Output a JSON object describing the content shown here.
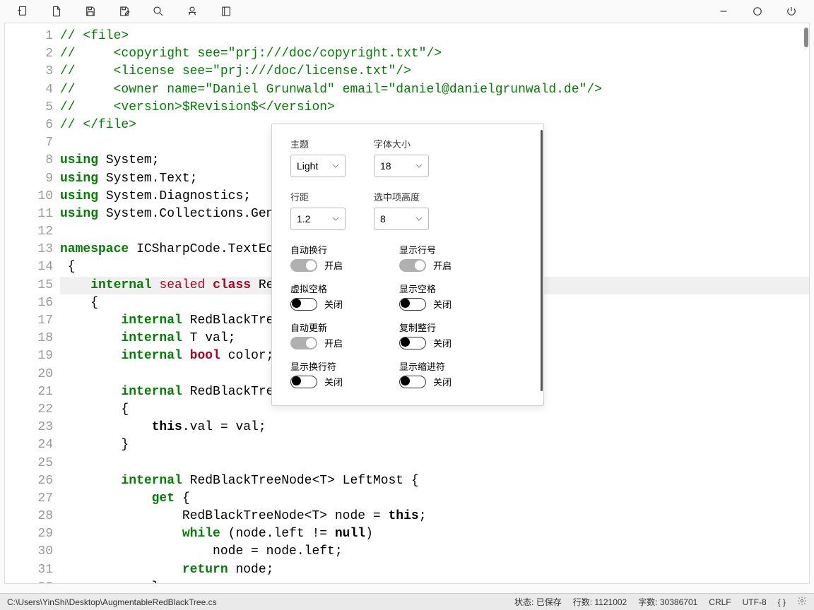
{
  "toolbar": {
    "icons": [
      "new-file-icon",
      "open-file-icon",
      "save-icon",
      "save-as-icon",
      "search-icon",
      "translate-icon",
      "book-icon"
    ],
    "right_icons": [
      "minimize-icon",
      "maximize-icon",
      "power-icon"
    ]
  },
  "settings": {
    "theme_label": "主题",
    "theme_value": "Light",
    "fontsize_label": "字体大小",
    "fontsize_value": "18",
    "lineheight_label": "行距",
    "lineheight_value": "1.2",
    "selheight_label": "选中项高度",
    "selheight_value": "8",
    "wrap_label": "自动换行",
    "wrap_state": "开启",
    "linenum_label": "显示行号",
    "linenum_state": "开启",
    "virtspace_label": "虚拟空格",
    "virtspace_state": "关闭",
    "showspace_label": "显示空格",
    "showspace_state": "关闭",
    "autoupdate_label": "自动更新",
    "autoupdate_state": "开启",
    "copyline_label": "复制整行",
    "copyline_state": "关闭",
    "showlinebreak_label": "显示换行符",
    "showlinebreak_state": "关闭",
    "showindent_label": "显示缩进符",
    "showindent_state": "关闭"
  },
  "code": {
    "lines": [
      {
        "n": 1,
        "html": "<span class='cmt'>// &lt;file&gt;</span>"
      },
      {
        "n": 2,
        "html": "<span class='cmt'>//     &lt;copyright see=\"prj:///doc/copyright.txt\"/&gt;</span>"
      },
      {
        "n": 3,
        "html": "<span class='cmt'>//     &lt;license see=\"prj:///doc/license.txt\"/&gt;</span>"
      },
      {
        "n": 4,
        "html": "<span class='cmt'>//     &lt;owner name=\"Daniel Grunwald\" email=\"daniel@danielgrunwald.de\"/&gt;</span>"
      },
      {
        "n": 5,
        "html": "<span class='cmt'>//     &lt;version&gt;$Revision$&lt;/version&gt;</span>"
      },
      {
        "n": 6,
        "html": "<span class='cmt'>// &lt;/file&gt;</span>"
      },
      {
        "n": 7,
        "html": ""
      },
      {
        "n": 8,
        "html": "<span class='kw'>using</span> System;"
      },
      {
        "n": 9,
        "html": "<span class='kw'>using</span> System.Text;"
      },
      {
        "n": 10,
        "html": "<span class='kw'>using</span> System.Diagnostics;"
      },
      {
        "n": 11,
        "html": "<span class='kw'>using</span> System.Collections.Gener"
      },
      {
        "n": 12,
        "html": ""
      },
      {
        "n": 13,
        "html": "<span class='kw'>namespace</span> ICSharpCode.TextEdit"
      },
      {
        "n": 14,
        "html": " {"
      },
      {
        "n": 15,
        "html": "    <span class='kw'>internal</span> <span class='kw3'>sealed</span> <span class='kw2'>class</span> RedB",
        "current": true
      },
      {
        "n": 16,
        "html": "    {"
      },
      {
        "n": 17,
        "html": "        <span class='kw'>internal</span> RedBlackTreeN"
      },
      {
        "n": 18,
        "html": "        <span class='kw'>internal</span> T val;"
      },
      {
        "n": 19,
        "html": "        <span class='kw'>internal</span> <span class='kw2'>bool</span> color;"
      },
      {
        "n": 20,
        "html": ""
      },
      {
        "n": 21,
        "html": "        <span class='kw'>internal</span> RedBlackTreeN"
      },
      {
        "n": 22,
        "html": "        {"
      },
      {
        "n": 23,
        "html": "            <span class='bold'>this</span>.val = val;"
      },
      {
        "n": 24,
        "html": "        }"
      },
      {
        "n": 25,
        "html": ""
      },
      {
        "n": 26,
        "html": "        <span class='kw'>internal</span> RedBlackTreeNode&lt;T&gt; LeftMost {"
      },
      {
        "n": 27,
        "html": "            <span class='kw'>get</span> {"
      },
      {
        "n": 28,
        "html": "                RedBlackTreeNode&lt;T&gt; node = <span class='bold'>this</span>;"
      },
      {
        "n": 29,
        "html": "                <span class='kw'>while</span> (node.left != <span class='bold'>null</span>)"
      },
      {
        "n": 30,
        "html": "                    node = node.left;"
      },
      {
        "n": 31,
        "html": "                <span class='kw'>return</span> node;"
      },
      {
        "n": 32,
        "html": "            }"
      }
    ]
  },
  "statusbar": {
    "path": "C:\\Users\\YinShi\\Desktop\\AugmentableRedBlackTree.cs",
    "status_label": "状态:",
    "status_value": "已保存",
    "lines_label": "行数:",
    "lines_value": "1121002",
    "chars_label": "字数:",
    "chars_value": "30386701",
    "eol": "CRLF",
    "encoding": "UTF-8",
    "bracket": "{ }"
  }
}
